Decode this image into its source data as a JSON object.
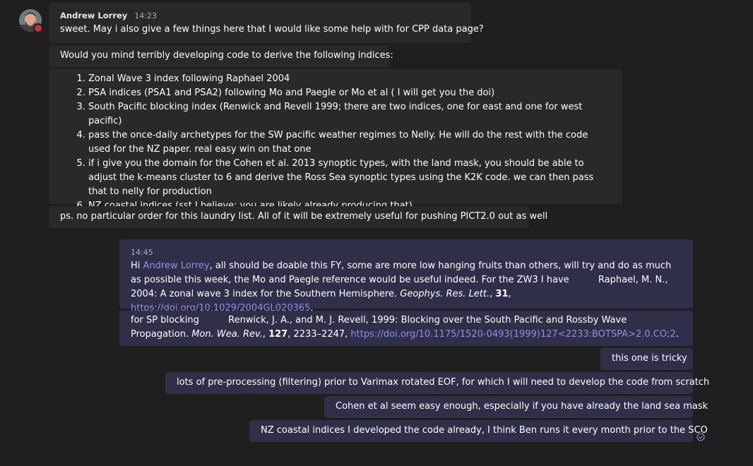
{
  "thread": {
    "author": "Andrew Lorrey",
    "author_time": "14:23",
    "reply_time": "14:45"
  },
  "incoming": {
    "m1": "sweet. May i also give a few things here that I would like some help with for CPP data page?",
    "m2": "Would you mind terribly developing code to derive the following indices:",
    "list": [
      "Zonal Wave 3 index following Raphael 2004",
      "PSA indices (PSA1 and PSA2) following Mo and Paegle or Mo et al ( I will get you the doi)",
      "South Pacific blocking index (Renwick and Revell 1999; there are two indices, one for east and one for west pacific)",
      "pass the once-daily archetypes for the SW pacific weather regimes to Nelly. He will do the rest with the code used for the NZ paper. real easy win on that one",
      "if i give you the domain for the Cohen et al. 2013 synoptic types, with the land mask, you should be able to adjust the k-means cluster to 6 and derive the Ross Sea synoptic types using the K2K code. we can then pass that to nelly for production",
      "NZ coastal indices (sst I believe; you are likely already producing that)"
    ],
    "m4": "ps. no particular order for this laundry list. All of it will be extremely useful for pushing PICT2.0 out as well"
  },
  "outgoing": {
    "r1": {
      "hi": "Hi ",
      "mention": "Andrew Lorrey",
      "text": ", all should be doable this FY, some are more low hanging fruits than others, will try and do as much as possible this week, the Mo and Paegle reference would be useful indeed. For the ZW3 I have          Raphael, M. N., 2004: A zonal wave 3 index for the Southern Hemisphere. ",
      "journal": "Geophys. Res. Lett.",
      "sep1": ", ",
      "volume": "31",
      "sep2": ", ",
      "link": "https://doi.org/10.1029/2004GL020365",
      "end": "."
    },
    "r2": {
      "text": "for SP blocking          Renwick, J. A., and M. J. Revell, 1999: Blocking over the South Pacific and Rossby Wave Propagation. ",
      "journal": "Mon. Wea. Rev.",
      "sep1": ", ",
      "volume": "127",
      "pages": ", 2233–2247, ",
      "link": "https://doi.org/10.1175/1520-0493(1999)127<2233:BOTSPA>2.0.CO;2",
      "end": "."
    },
    "r3": "this one is tricky",
    "r4": "lots of pre-processing (filtering) prior to Varimax rotated EOF, for which I will need to develop the code from scratch",
    "r5": "Cohen et al seem easy enough, especially if you have already the land sea mask",
    "r6": "NZ coastal indices I developed the code already, I think Ben runs it every month prior to the SCO"
  },
  "colors": {
    "background": "#1f1f1f",
    "incoming_bubble": "#292929",
    "outgoing_bubble": "#2f2f4a",
    "link": "#8f8fe6",
    "presence_busy": "#c4314b"
  },
  "icons": {
    "avatar": "user-avatar",
    "presence": "presence-busy-icon",
    "read_receipt": "read-receipt-icon"
  }
}
